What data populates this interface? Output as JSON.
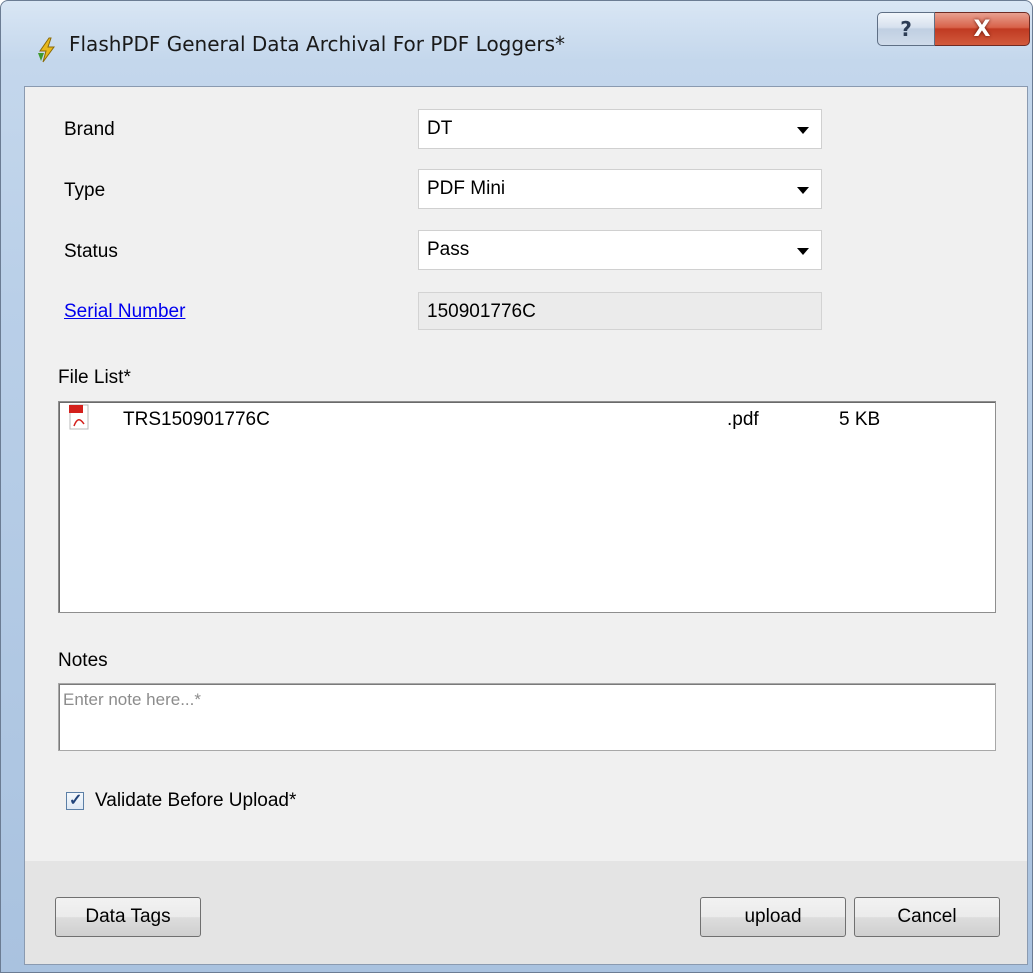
{
  "window": {
    "title": "FlashPDF General Data Archival For PDF Loggers*",
    "help_glyph": "?",
    "close_glyph": "X"
  },
  "form": {
    "brand": {
      "label": "Brand",
      "value": "DT"
    },
    "type": {
      "label": "Type",
      "value": "PDF Mini"
    },
    "status": {
      "label": "Status",
      "value": "Pass"
    },
    "serial": {
      "label": "Serial Number",
      "value": "150901776C"
    }
  },
  "file_list": {
    "label": "File List*",
    "files": [
      {
        "name": "TRS150901776C",
        "ext": ".pdf",
        "size": "5 KB",
        "icon": "pdf-file-icon"
      }
    ]
  },
  "notes": {
    "label": "Notes",
    "placeholder": "Enter note here...*",
    "value": ""
  },
  "validate": {
    "label": "Validate Before Upload*",
    "checked": true
  },
  "buttons": {
    "data_tags": "Data Tags",
    "upload": "upload",
    "cancel": "Cancel"
  },
  "colors": {
    "link": "#0000ee",
    "close_button": "#c03a22",
    "client_background": "#f0f0f0"
  }
}
